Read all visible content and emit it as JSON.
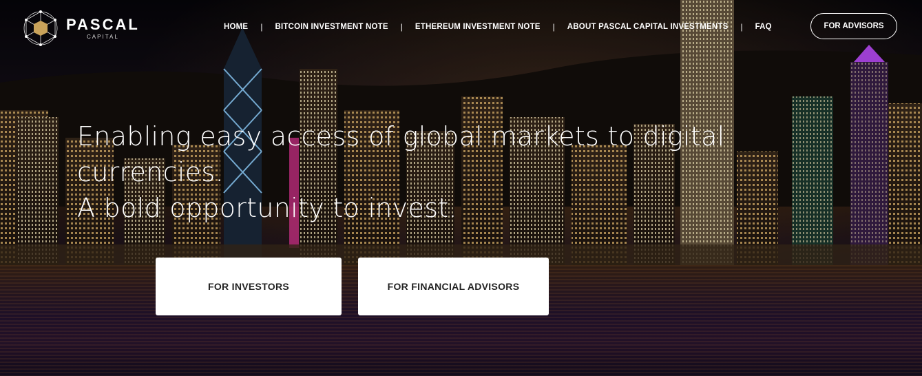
{
  "brand": {
    "name": "PASCAL",
    "subtitle": "CAPITAL",
    "logo_icon": "geometric-network-logo"
  },
  "nav": {
    "items": [
      {
        "label": "HOME"
      },
      {
        "label": "BITCOIN INVESTMENT NOTE"
      },
      {
        "label": "ETHEREUM INVESTMENT NOTE"
      },
      {
        "label": "ABOUT PASCAL CAPITAL INVESTMENTS"
      },
      {
        "label": "FAQ"
      }
    ],
    "separator": "|",
    "cta_label": "FOR ADVISORS"
  },
  "hero": {
    "line1": "Enabling easy access of global markets to digital",
    "line2": "currencies.",
    "line3": "A bold opportunity to invest.",
    "buttons": {
      "investors": "FOR INVESTORS",
      "advisors": "FOR FINANCIAL ADVISORS"
    }
  },
  "colors": {
    "accent": "#c9a25a",
    "text": "#ffffff",
    "button_bg": "#ffffff",
    "button_text": "#222222"
  }
}
